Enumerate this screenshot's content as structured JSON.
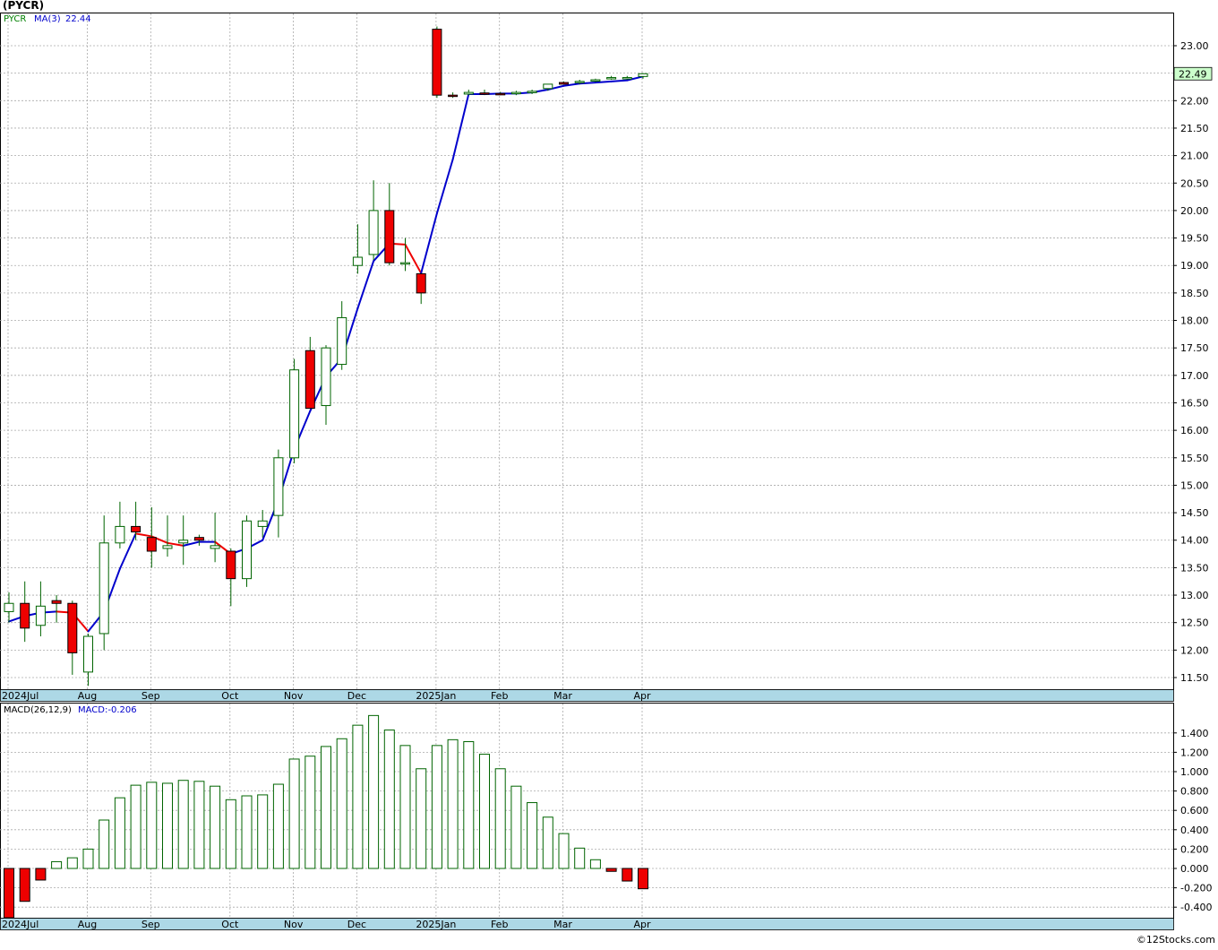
{
  "title": "(PYCR)",
  "footer": "©12Stocks.com",
  "colors": {
    "up_fill": "#ffffff",
    "up_stroke": "#006400",
    "down_fill": "#ee0000",
    "down_stroke": "#000000",
    "ma_up": "#0000cc",
    "ma_down": "#ee0000",
    "axis_bar": "#add8e6",
    "grid": "#aaaaaa",
    "last_price_bg": "#ccffcc"
  },
  "price_panel": {
    "legend": {
      "symbol": "PYCR",
      "ma_label": "MA(3)",
      "ma_value": "22.44"
    },
    "last_price_tag": "22.49",
    "y_ticks": [
      "23.00",
      "22.50",
      "22.00",
      "21.50",
      "21.00",
      "20.50",
      "20.00",
      "19.50",
      "19.00",
      "18.50",
      "18.00",
      "17.50",
      "17.00",
      "16.50",
      "16.00",
      "15.50",
      "15.00",
      "14.50",
      "14.00",
      "13.50",
      "13.00",
      "12.50",
      "12.00",
      "11.50"
    ]
  },
  "macd_panel": {
    "legend": {
      "label": "MACD(26,12,9)",
      "value_label": "MACD:-0.206"
    },
    "y_ticks": [
      "1.400",
      "1.200",
      "1.000",
      "0.800",
      "0.600",
      "0.400",
      "0.200",
      "0.000",
      "-0.200",
      "-0.400"
    ]
  },
  "x_labels": [
    "2024Jul",
    "Aug",
    "Sep",
    "Oct",
    "Nov",
    "Dec",
    "2025Jan",
    "Feb",
    "Mar",
    "Apr"
  ],
  "chart_data": [
    {
      "type": "candlestick",
      "title": "(PYCR)",
      "interval": "weekly",
      "ylim": [
        11.2,
        23.5
      ],
      "x_labels": [
        "2024Jul",
        "Aug",
        "Sep",
        "Oct",
        "Nov",
        "Dec",
        "2025Jan",
        "Feb",
        "Mar",
        "Apr"
      ],
      "x_label_bar_index": [
        0,
        5,
        9,
        14,
        18,
        22,
        27,
        31,
        35,
        40
      ],
      "candles": [
        {
          "o": 12.7,
          "h": 13.05,
          "l": 12.5,
          "c": 12.85
        },
        {
          "o": 12.85,
          "h": 13.25,
          "l": 12.15,
          "c": 12.4
        },
        {
          "o": 12.45,
          "h": 13.25,
          "l": 12.25,
          "c": 12.8
        },
        {
          "o": 12.9,
          "h": 13.0,
          "l": 12.5,
          "c": 12.85
        },
        {
          "o": 12.85,
          "h": 12.9,
          "l": 11.55,
          "c": 11.95
        },
        {
          "o": 11.6,
          "h": 12.3,
          "l": 11.35,
          "c": 12.25
        },
        {
          "o": 12.3,
          "h": 14.45,
          "l": 12.0,
          "c": 13.95
        },
        {
          "o": 13.95,
          "h": 14.7,
          "l": 13.85,
          "c": 14.25
        },
        {
          "o": 14.25,
          "h": 14.7,
          "l": 14.0,
          "c": 14.15
        },
        {
          "o": 14.05,
          "h": 14.6,
          "l": 13.5,
          "c": 13.8
        },
        {
          "o": 13.85,
          "h": 14.45,
          "l": 13.7,
          "c": 13.9
        },
        {
          "o": 13.95,
          "h": 14.45,
          "l": 13.55,
          "c": 14.0
        },
        {
          "o": 14.05,
          "h": 14.1,
          "l": 13.9,
          "c": 14.0
        },
        {
          "o": 13.85,
          "h": 14.5,
          "l": 13.6,
          "c": 13.9
        },
        {
          "o": 13.8,
          "h": 13.85,
          "l": 12.8,
          "c": 13.3
        },
        {
          "o": 13.3,
          "h": 14.45,
          "l": 13.15,
          "c": 14.35
        },
        {
          "o": 14.25,
          "h": 14.55,
          "l": 14.05,
          "c": 14.35
        },
        {
          "o": 14.45,
          "h": 15.65,
          "l": 14.05,
          "c": 15.5
        },
        {
          "o": 15.5,
          "h": 17.3,
          "l": 15.4,
          "c": 17.1
        },
        {
          "o": 17.45,
          "h": 17.7,
          "l": 16.4,
          "c": 16.4
        },
        {
          "o": 16.45,
          "h": 17.55,
          "l": 16.1,
          "c": 17.5
        },
        {
          "o": 17.2,
          "h": 18.35,
          "l": 17.1,
          "c": 18.05
        },
        {
          "o": 19.0,
          "h": 19.75,
          "l": 18.85,
          "c": 19.15
        },
        {
          "o": 19.2,
          "h": 20.55,
          "l": 19.1,
          "c": 20.0
        },
        {
          "o": 20.0,
          "h": 20.5,
          "l": 19.0,
          "c": 19.05
        },
        {
          "o": 19.05,
          "h": 19.5,
          "l": 18.9,
          "c": 19.05
        },
        {
          "o": 18.85,
          "h": 18.85,
          "l": 18.3,
          "c": 18.5
        },
        {
          "o": 23.3,
          "h": 23.35,
          "l": 22.05,
          "c": 22.1
        },
        {
          "o": 22.1,
          "h": 22.15,
          "l": 22.05,
          "c": 22.08
        },
        {
          "o": 22.12,
          "h": 22.2,
          "l": 22.1,
          "c": 22.15
        },
        {
          "o": 22.14,
          "h": 22.2,
          "l": 22.1,
          "c": 22.13
        },
        {
          "o": 22.13,
          "h": 22.16,
          "l": 22.1,
          "c": 22.12
        },
        {
          "o": 22.14,
          "h": 22.18,
          "l": 22.1,
          "c": 22.15
        },
        {
          "o": 22.15,
          "h": 22.2,
          "l": 22.12,
          "c": 22.17
        },
        {
          "o": 22.22,
          "h": 22.3,
          "l": 22.18,
          "c": 22.3
        },
        {
          "o": 22.33,
          "h": 22.35,
          "l": 22.3,
          "c": 22.3
        },
        {
          "o": 22.33,
          "h": 22.38,
          "l": 22.3,
          "c": 22.35
        },
        {
          "o": 22.37,
          "h": 22.4,
          "l": 22.34,
          "c": 22.38
        },
        {
          "o": 22.4,
          "h": 22.45,
          "l": 22.38,
          "c": 22.42
        },
        {
          "o": 22.42,
          "h": 22.45,
          "l": 22.38,
          "c": 22.42
        },
        {
          "o": 22.44,
          "h": 22.5,
          "l": 22.4,
          "c": 22.49
        }
      ],
      "ma3": [
        12.52,
        12.62,
        12.68,
        12.7,
        12.68,
        12.34,
        12.7,
        13.48,
        14.12,
        14.07,
        13.95,
        13.9,
        13.97,
        13.97,
        13.75,
        13.85,
        14.0,
        14.73,
        15.66,
        16.35,
        16.98,
        17.31,
        18.22,
        19.08,
        19.4,
        19.38,
        18.86,
        19.95,
        20.93,
        22.12,
        22.12,
        22.13,
        22.13,
        22.15,
        22.2,
        22.27,
        22.31,
        22.33,
        22.35,
        22.37,
        22.44
      ]
    },
    {
      "type": "bar",
      "title": "MACD(26,12,9)",
      "ylim": [
        -0.52,
        1.6
      ],
      "values": [
        -0.52,
        -0.34,
        -0.12,
        0.07,
        0.11,
        0.2,
        0.5,
        0.73,
        0.86,
        0.89,
        0.88,
        0.91,
        0.9,
        0.85,
        0.71,
        0.75,
        0.76,
        0.87,
        1.13,
        1.16,
        1.26,
        1.34,
        1.48,
        1.58,
        1.43,
        1.27,
        1.03,
        1.27,
        1.33,
        1.31,
        1.18,
        1.03,
        0.85,
        0.68,
        0.53,
        0.36,
        0.21,
        0.09,
        -0.03,
        -0.13,
        -0.21
      ]
    }
  ]
}
